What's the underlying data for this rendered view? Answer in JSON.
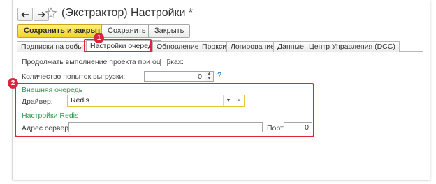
{
  "window": {
    "title": "(Экстрактор) Настройки *"
  },
  "toolbar": {
    "save_close_label": "Сохранить и закрыть",
    "save_label": "Сохранить",
    "close_label": "Закрыть"
  },
  "tabs": [
    {
      "label": "Подписки на события"
    },
    {
      "label": "Настройки очереди"
    },
    {
      "label": "Обновление"
    },
    {
      "label": "Прокси"
    },
    {
      "label": "Логирование"
    },
    {
      "label": "Данные"
    },
    {
      "label": "Центр Управления (DCC)"
    }
  ],
  "annotations": {
    "badge1": "1",
    "badge2": "2",
    "color": "#e0243a"
  },
  "queue_settings": {
    "continue_on_error_label": "Продолжать выполнение проекта при ошибках:",
    "continue_on_error_checked": false,
    "retry_count_label": "Количество попыток выгрузки:",
    "retry_count_value": "0",
    "help_icon": "?",
    "external_queue_header": "Внешняя очередь",
    "driver_label": "Драйвер:",
    "driver_value": "Redis",
    "redis_header": "Настройки Redis",
    "server_address_label": "Адрес сервера:",
    "server_address_value": "",
    "port_label": "Порт:",
    "port_value": "0"
  },
  "colors": {
    "primary_button": "#f3d22a",
    "section_header": "#2e9a4b",
    "help": "#2979c6"
  }
}
